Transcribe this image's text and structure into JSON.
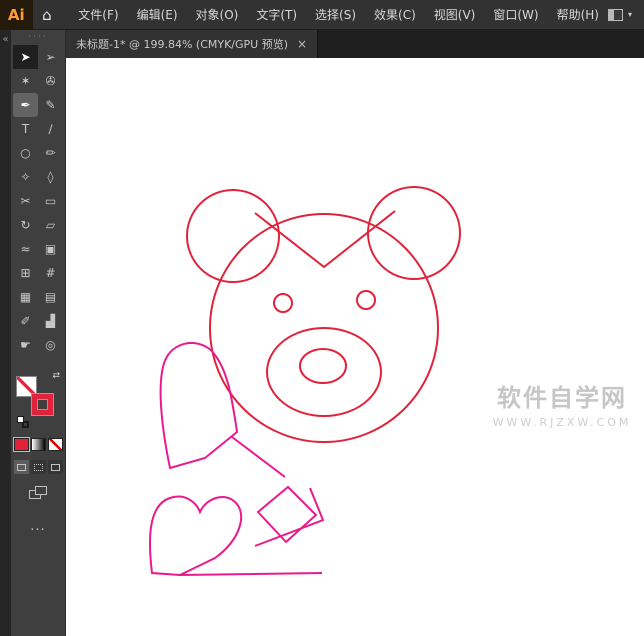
{
  "app": {
    "logo": "Ai",
    "home_icon": "⌂"
  },
  "menubar": {
    "items": [
      "文件(F)",
      "编辑(E)",
      "对象(O)",
      "文字(T)",
      "选择(S)",
      "效果(C)",
      "视图(V)",
      "窗口(W)",
      "帮助(H)"
    ],
    "chevron": "▾"
  },
  "tabbar": {
    "tab_title": "未标题-1* @ 199.84% (CMYK/GPU 预览)",
    "close": "×"
  },
  "dock": {
    "collapse_icon": "«",
    "handle": "····",
    "swap_icon": "⇄",
    "ellipsis": "···"
  },
  "tools": [
    {
      "name": "selection",
      "glyph": "➤",
      "state": "selected"
    },
    {
      "name": "direct-selection",
      "glyph": "➢"
    },
    {
      "name": "magic-wand",
      "glyph": "✶"
    },
    {
      "name": "lasso",
      "glyph": "✇"
    },
    {
      "name": "pen",
      "glyph": "✒",
      "state": "active"
    },
    {
      "name": "paintbrush",
      "glyph": "✎"
    },
    {
      "name": "type",
      "glyph": "T"
    },
    {
      "name": "line-segment",
      "glyph": "∕"
    },
    {
      "name": "ellipse",
      "glyph": "○"
    },
    {
      "name": "pencil",
      "glyph": "✏"
    },
    {
      "name": "shaper",
      "glyph": "✧"
    },
    {
      "name": "eraser",
      "glyph": "◊"
    },
    {
      "name": "scissors",
      "glyph": "✂"
    },
    {
      "name": "artboard",
      "glyph": "▭"
    },
    {
      "name": "rotate",
      "glyph": "↻"
    },
    {
      "name": "scale",
      "glyph": "▱"
    },
    {
      "name": "width",
      "glyph": "≈"
    },
    {
      "name": "free-transform",
      "glyph": "▣"
    },
    {
      "name": "shape-builder",
      "glyph": "⊞"
    },
    {
      "name": "perspective-grid",
      "glyph": "#"
    },
    {
      "name": "mesh",
      "glyph": "▦"
    },
    {
      "name": "gradient",
      "glyph": "▤"
    },
    {
      "name": "eyedropper",
      "glyph": "✐"
    },
    {
      "name": "graph",
      "glyph": "▟"
    },
    {
      "name": "hand",
      "glyph": "☛"
    },
    {
      "name": "zoom",
      "glyph": "◎"
    }
  ],
  "color_controls": {
    "fill": "none",
    "stroke": "#e0233a"
  },
  "drawing": {
    "bear_color": "#e0233a",
    "hand_color": "#ea1a8c",
    "stroke_width": "2"
  },
  "watermark": {
    "line1": "软件自学网",
    "line2": "WWW.RJZXW.COM"
  }
}
